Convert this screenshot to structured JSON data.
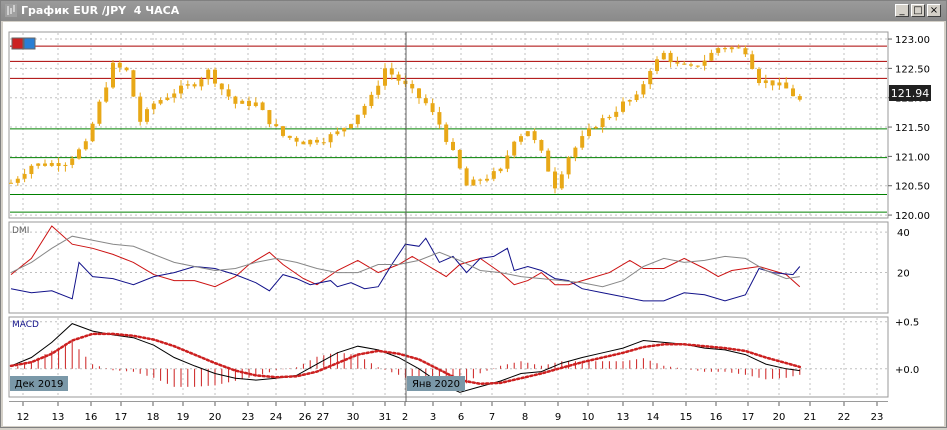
{
  "window": {
    "title": "График EUR /JPY  4 ЧАСА"
  },
  "window_buttons": {
    "minimize": "_",
    "maximize": "□",
    "close": "×"
  },
  "price_label": "121.94",
  "panels": {
    "dmi_label": "DMI",
    "macd_label": "MACD"
  },
  "period_markers": [
    "Дек 2019",
    "Янв 2020"
  ],
  "colors": {
    "candle": "#e8a817",
    "dmi_red": "#cc1111",
    "dmi_blue": "#11118a",
    "dmi_gray": "#888888",
    "macd_line": "#000000",
    "macd_signal": "#cc2020",
    "macd_hist": "#cc2020",
    "support": "#008000",
    "resistance": "#aa0000"
  },
  "chart_data": [
    {
      "type": "candlestick",
      "x_ticks": [
        "12",
        "13",
        "16",
        "17",
        "18",
        "19",
        "20",
        "23",
        "24",
        "26",
        "27",
        "30",
        "31",
        "2",
        "3",
        "6",
        "7",
        "8",
        "9",
        "10",
        "13",
        "14",
        "15",
        "16",
        "17",
        "20",
        "21",
        "22",
        "23"
      ],
      "y_ticks": [
        "123.00",
        "122.50",
        "122.00",
        "121.50",
        "121.00",
        "120.50",
        "120.00"
      ],
      "ylim": [
        119.95,
        123.12
      ],
      "current_price": 121.94,
      "horizontal_lines": [
        {
          "value": 122.88,
          "color": "resistance"
        },
        {
          "value": 122.62,
          "color": "resistance"
        },
        {
          "value": 122.33,
          "color": "resistance"
        },
        {
          "value": 121.47,
          "color": "support"
        },
        {
          "value": 120.98,
          "color": "support"
        },
        {
          "value": 120.35,
          "color": "support"
        },
        {
          "value": 120.05,
          "color": "support"
        }
      ],
      "close_path": [
        [
          0,
          120.55
        ],
        [
          3,
          120.85
        ],
        [
          8,
          120.9
        ],
        [
          11,
          121.2
        ],
        [
          13,
          121.9
        ],
        [
          15,
          122.55
        ],
        [
          17,
          122.45
        ],
        [
          19,
          121.6
        ],
        [
          21,
          121.9
        ],
        [
          24,
          122.1
        ],
        [
          27,
          122.25
        ],
        [
          29,
          122.45
        ],
        [
          31,
          122.15
        ],
        [
          33,
          121.9
        ],
        [
          36,
          121.9
        ],
        [
          38,
          121.6
        ],
        [
          40,
          121.35
        ],
        [
          43,
          121.25
        ],
        [
          46,
          121.3
        ],
        [
          48,
          121.4
        ],
        [
          50,
          121.6
        ],
        [
          53,
          122.0
        ],
        [
          55,
          122.5
        ],
        [
          57,
          122.3
        ],
        [
          59,
          122.1
        ],
        [
          61,
          121.9
        ],
        [
          63,
          121.55
        ],
        [
          65,
          121.05
        ],
        [
          67,
          120.5
        ],
        [
          69,
          120.6
        ],
        [
          72,
          120.75
        ],
        [
          74,
          121.3
        ],
        [
          76,
          121.45
        ],
        [
          78,
          121.05
        ],
        [
          80,
          120.5
        ],
        [
          82,
          121.0
        ],
        [
          84,
          121.3
        ],
        [
          86,
          121.55
        ],
        [
          88,
          121.7
        ],
        [
          90,
          121.9
        ],
        [
          92,
          122.0
        ],
        [
          94,
          122.5
        ],
        [
          96,
          122.75
        ],
        [
          98,
          122.55
        ],
        [
          100,
          122.5
        ],
        [
          102,
          122.65
        ],
        [
          104,
          122.85
        ],
        [
          106,
          122.85
        ],
        [
          108,
          122.8
        ],
        [
          110,
          122.3
        ],
        [
          112,
          122.25
        ],
        [
          114,
          122.15
        ],
        [
          116,
          121.95
        ]
      ]
    },
    {
      "type": "line",
      "name": "DMI",
      "y_ticks": [
        "40",
        "20"
      ],
      "ylim": [
        0,
        45
      ],
      "series": [
        {
          "color": "dmi_red",
          "points": [
            [
              0,
              19
            ],
            [
              3,
              27
            ],
            [
              6,
              43
            ],
            [
              9,
              34
            ],
            [
              12,
              32
            ],
            [
              15,
              29
            ],
            [
              18,
              25
            ],
            [
              21,
              19
            ],
            [
              24,
              16
            ],
            [
              27,
              16
            ],
            [
              30,
              13
            ],
            [
              33,
              18
            ],
            [
              35,
              24
            ],
            [
              38,
              30
            ],
            [
              40,
              24
            ],
            [
              43,
              17
            ],
            [
              45,
              14
            ],
            [
              48,
              21
            ],
            [
              51,
              26
            ],
            [
              54,
              20
            ],
            [
              57,
              24
            ],
            [
              59,
              28
            ],
            [
              61,
              24
            ],
            [
              64,
              18
            ],
            [
              66,
              24
            ],
            [
              69,
              27
            ],
            [
              72,
              20
            ],
            [
              74,
              14
            ],
            [
              76,
              16
            ],
            [
              78,
              20
            ],
            [
              80,
              14
            ],
            [
              82,
              14
            ],
            [
              85,
              17
            ],
            [
              88,
              20
            ],
            [
              91,
              26
            ],
            [
              93,
              22
            ],
            [
              96,
              22
            ],
            [
              99,
              27
            ],
            [
              102,
              22
            ],
            [
              104,
              18
            ],
            [
              106,
              21
            ],
            [
              108,
              22
            ],
            [
              110,
              23
            ],
            [
              112,
              21
            ],
            [
              114,
              19
            ],
            [
              116,
              13
            ]
          ]
        },
        {
          "color": "dmi_blue",
          "points": [
            [
              0,
              12
            ],
            [
              3,
              10
            ],
            [
              6,
              11
            ],
            [
              9,
              7
            ],
            [
              10,
              25
            ],
            [
              12,
              18
            ],
            [
              15,
              17
            ],
            [
              18,
              14
            ],
            [
              21,
              18
            ],
            [
              24,
              20
            ],
            [
              27,
              23
            ],
            [
              30,
              22
            ],
            [
              33,
              19
            ],
            [
              36,
              15
            ],
            [
              38,
              11
            ],
            [
              40,
              19
            ],
            [
              42,
              17
            ],
            [
              44,
              14
            ],
            [
              47,
              16
            ],
            [
              48,
              13
            ],
            [
              50,
              15
            ],
            [
              52,
              12
            ],
            [
              54,
              13
            ],
            [
              56,
              24
            ],
            [
              58,
              34
            ],
            [
              60,
              33
            ],
            [
              61,
              37
            ],
            [
              63,
              25
            ],
            [
              65,
              28
            ],
            [
              67,
              20
            ],
            [
              69,
              27
            ],
            [
              71,
              28
            ],
            [
              73,
              32
            ],
            [
              74,
              21
            ],
            [
              76,
              23
            ],
            [
              78,
              21
            ],
            [
              80,
              17
            ],
            [
              82,
              16
            ],
            [
              84,
              12
            ],
            [
              87,
              10
            ],
            [
              90,
              8
            ],
            [
              93,
              6
            ],
            [
              96,
              6
            ],
            [
              99,
              10
            ],
            [
              102,
              9
            ],
            [
              105,
              6
            ],
            [
              108,
              9
            ],
            [
              110,
              22
            ],
            [
              112,
              20
            ],
            [
              115,
              19
            ],
            [
              116,
              23
            ]
          ]
        },
        {
          "color": "dmi_gray",
          "points": [
            [
              0,
              20
            ],
            [
              3,
              25
            ],
            [
              6,
              32
            ],
            [
              9,
              38
            ],
            [
              12,
              36
            ],
            [
              15,
              34
            ],
            [
              18,
              33
            ],
            [
              21,
              29
            ],
            [
              24,
              25
            ],
            [
              27,
              23
            ],
            [
              30,
              21
            ],
            [
              33,
              22
            ],
            [
              36,
              25
            ],
            [
              39,
              27
            ],
            [
              42,
              25
            ],
            [
              45,
              22
            ],
            [
              48,
              20
            ],
            [
              51,
              20
            ],
            [
              54,
              24
            ],
            [
              57,
              24
            ],
            [
              60,
              26
            ],
            [
              63,
              30
            ],
            [
              66,
              26
            ],
            [
              69,
              21
            ],
            [
              72,
              20
            ],
            [
              75,
              18
            ],
            [
              78,
              17
            ],
            [
              81,
              16
            ],
            [
              84,
              15
            ],
            [
              87,
              13
            ],
            [
              90,
              16
            ],
            [
              93,
              23
            ],
            [
              96,
              27
            ],
            [
              99,
              25
            ],
            [
              102,
              26
            ],
            [
              105,
              28
            ],
            [
              108,
              27
            ],
            [
              111,
              21
            ],
            [
              114,
              17
            ],
            [
              116,
              18
            ]
          ]
        }
      ]
    },
    {
      "type": "line",
      "name": "MACD",
      "y_ticks": [
        "+0.5",
        "+0.0"
      ],
      "ylim": [
        -0.3,
        0.55
      ],
      "series": [
        {
          "color": "macd_line",
          "points": [
            [
              0,
              0.03
            ],
            [
              3,
              0.12
            ],
            [
              6,
              0.28
            ],
            [
              9,
              0.48
            ],
            [
              12,
              0.4
            ],
            [
              15,
              0.36
            ],
            [
              18,
              0.33
            ],
            [
              21,
              0.25
            ],
            [
              24,
              0.12
            ],
            [
              27,
              0.03
            ],
            [
              30,
              -0.05
            ],
            [
              33,
              -0.1
            ],
            [
              36,
              -0.12
            ],
            [
              39,
              -0.1
            ],
            [
              42,
              -0.07
            ],
            [
              45,
              0.05
            ],
            [
              48,
              0.17
            ],
            [
              51,
              0.24
            ],
            [
              54,
              0.2
            ],
            [
              57,
              0.12
            ],
            [
              60,
              0.0
            ],
            [
              63,
              -0.15
            ],
            [
              66,
              -0.25
            ],
            [
              69,
              -0.19
            ],
            [
              72,
              -0.13
            ],
            [
              75,
              -0.05
            ],
            [
              78,
              -0.03
            ],
            [
              81,
              0.06
            ],
            [
              84,
              0.12
            ],
            [
              87,
              0.17
            ],
            [
              90,
              0.22
            ],
            [
              93,
              0.3
            ],
            [
              96,
              0.28
            ],
            [
              99,
              0.26
            ],
            [
              102,
              0.22
            ],
            [
              105,
              0.2
            ],
            [
              108,
              0.15
            ],
            [
              111,
              0.05
            ],
            [
              114,
              0.0
            ],
            [
              116,
              -0.02
            ]
          ]
        },
        {
          "color": "macd_signal",
          "dotted": true,
          "points": [
            [
              0,
              0.03
            ],
            [
              3,
              0.07
            ],
            [
              6,
              0.16
            ],
            [
              9,
              0.3
            ],
            [
              12,
              0.37
            ],
            [
              15,
              0.37
            ],
            [
              18,
              0.35
            ],
            [
              21,
              0.31
            ],
            [
              24,
              0.24
            ],
            [
              27,
              0.15
            ],
            [
              30,
              0.06
            ],
            [
              33,
              -0.02
            ],
            [
              36,
              -0.07
            ],
            [
              39,
              -0.09
            ],
            [
              42,
              -0.08
            ],
            [
              45,
              -0.03
            ],
            [
              48,
              0.06
            ],
            [
              51,
              0.15
            ],
            [
              54,
              0.19
            ],
            [
              57,
              0.16
            ],
            [
              60,
              0.1
            ],
            [
              63,
              -0.01
            ],
            [
              66,
              -0.12
            ],
            [
              69,
              -0.16
            ],
            [
              72,
              -0.15
            ],
            [
              75,
              -0.1
            ],
            [
              78,
              -0.05
            ],
            [
              81,
              0.01
            ],
            [
              84,
              0.07
            ],
            [
              87,
              0.12
            ],
            [
              90,
              0.17
            ],
            [
              93,
              0.23
            ],
            [
              96,
              0.26
            ],
            [
              99,
              0.26
            ],
            [
              102,
              0.24
            ],
            [
              105,
              0.22
            ],
            [
              108,
              0.19
            ],
            [
              111,
              0.12
            ],
            [
              114,
              0.06
            ],
            [
              116,
              0.02
            ]
          ]
        }
      ]
    }
  ]
}
